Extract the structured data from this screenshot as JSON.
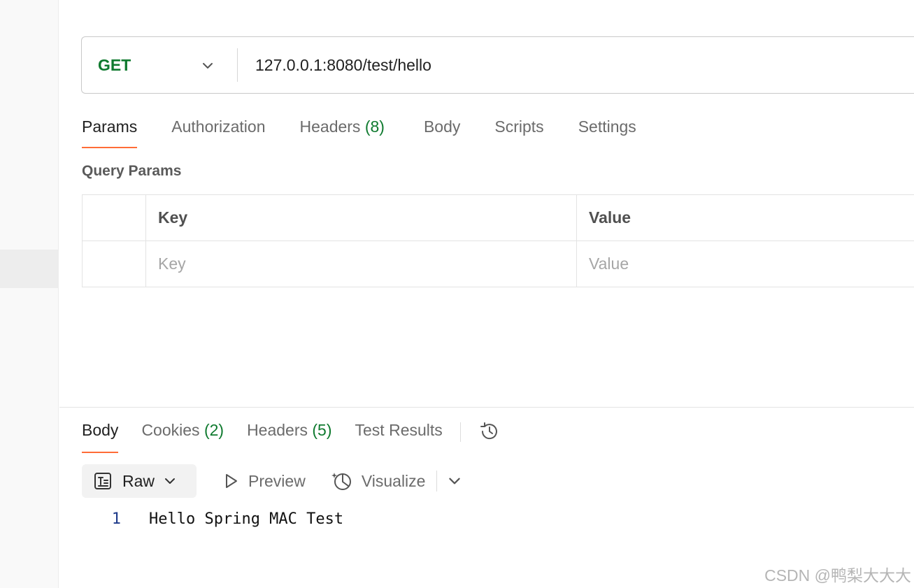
{
  "request": {
    "method": "GET",
    "url": "127.0.0.1:8080/test/hello"
  },
  "request_tabs": [
    {
      "label": "Params",
      "count": ""
    },
    {
      "label": "Authorization",
      "count": ""
    },
    {
      "label": "Headers",
      "count": "(8)"
    },
    {
      "label": "Body",
      "count": ""
    },
    {
      "label": "Scripts",
      "count": ""
    },
    {
      "label": "Settings",
      "count": ""
    }
  ],
  "query_params": {
    "title": "Query Params",
    "columns": {
      "key": "Key",
      "value": "Value"
    },
    "placeholder": {
      "key": "Key",
      "value": "Value"
    }
  },
  "response_tabs": [
    {
      "label": "Body",
      "count": ""
    },
    {
      "label": "Cookies",
      "count": "(2)"
    },
    {
      "label": "Headers",
      "count": "(5)"
    },
    {
      "label": "Test Results",
      "count": ""
    }
  ],
  "response_format": {
    "raw": "Raw",
    "preview": "Preview",
    "visualize": "Visualize"
  },
  "response_body": {
    "line_number": "1",
    "text": "Hello Spring MAC Test"
  },
  "watermark": "CSDN @鸭梨大大大",
  "colors": {
    "method_get": "#0f7a2f",
    "active_tab_underline": "#ff6c37",
    "count_green": "#0f7a2f"
  },
  "icons": [
    "chevron-down-icon",
    "history-icon",
    "raw-text-icon",
    "preview-play-icon",
    "visualize-icon"
  ]
}
